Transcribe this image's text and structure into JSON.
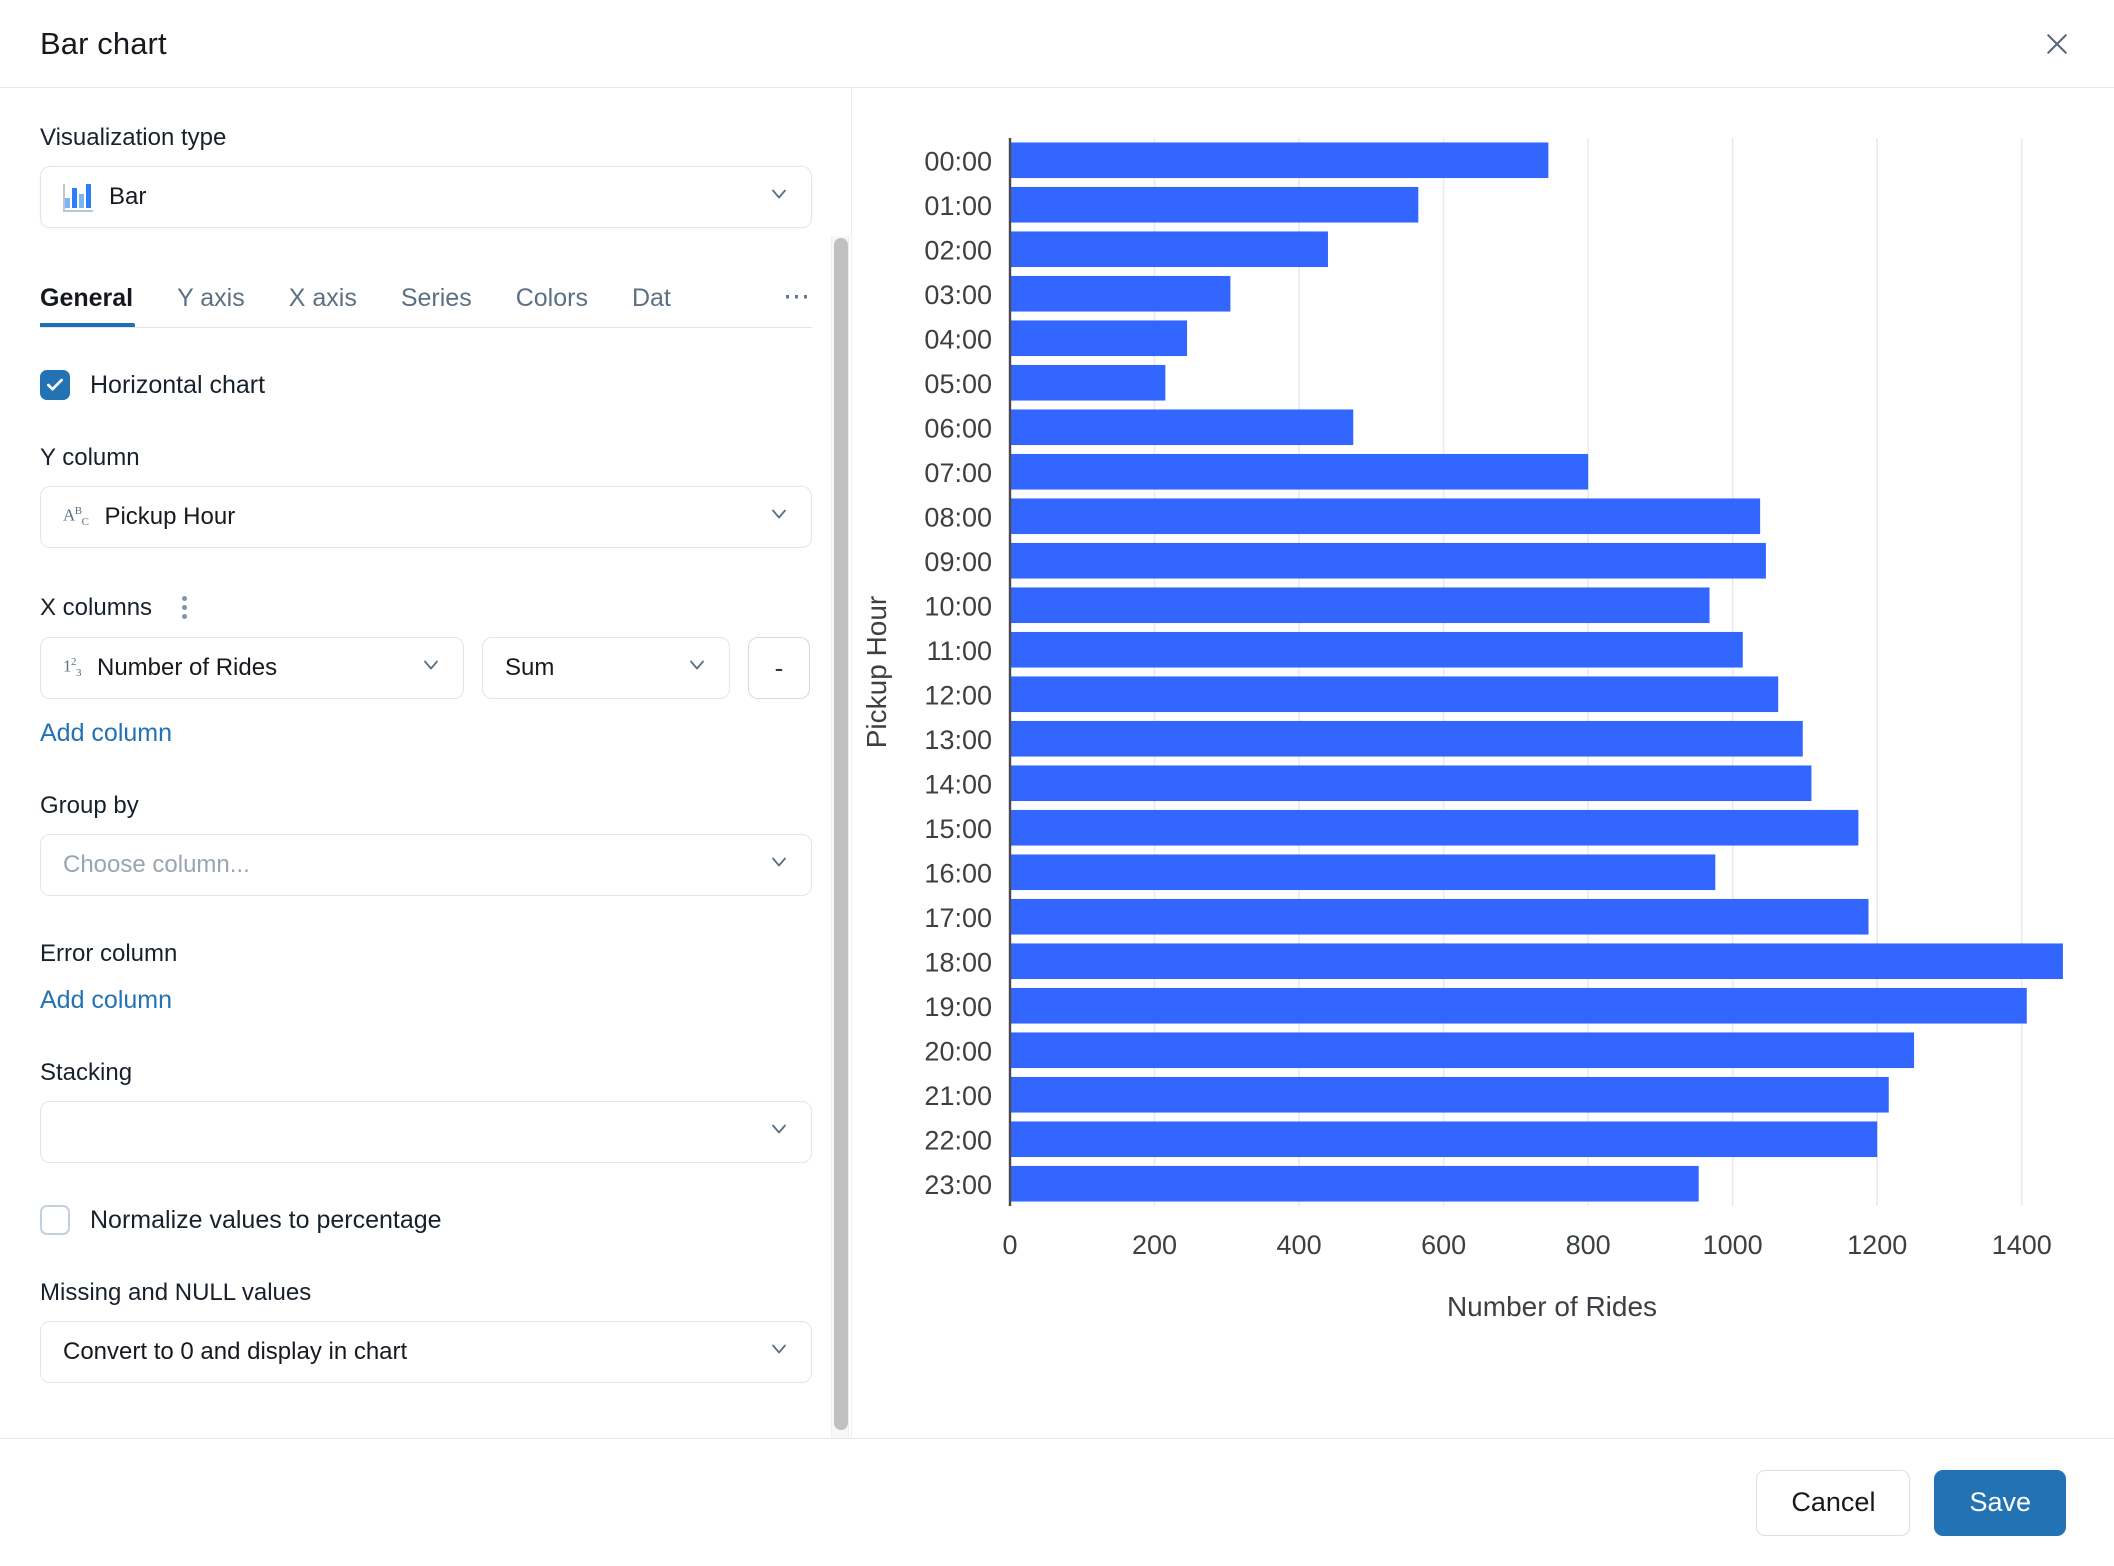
{
  "header": {
    "title": "Bar chart",
    "close_icon": "close-icon"
  },
  "settings": {
    "visualization_type_label": "Visualization type",
    "visualization_type_value": "Bar",
    "visualization_type_icon": "bar-chart-icon",
    "tabs": [
      {
        "label": "General",
        "active": true
      },
      {
        "label": "Y axis",
        "active": false
      },
      {
        "label": "X axis",
        "active": false
      },
      {
        "label": "Series",
        "active": false
      },
      {
        "label": "Colors",
        "active": false
      },
      {
        "label": "Dat",
        "active": false
      }
    ],
    "tabs_overflow": "⋯",
    "horizontal_chart_label": "Horizontal chart",
    "horizontal_chart_checked": true,
    "y_column_label": "Y column",
    "y_column_value": "Pickup Hour",
    "y_column_type_icon": "abc-text-type-icon",
    "x_columns_label": "X columns",
    "x_column_value": "Number of Rides",
    "x_column_type_icon": "123-number-type-icon",
    "x_aggregation_value": "Sum",
    "x_remove_label": "-",
    "x_add_column_label": "Add column",
    "group_by_label": "Group by",
    "group_by_placeholder": "Choose column...",
    "group_by_value": "",
    "error_column_label": "Error column",
    "error_add_column_label": "Add column",
    "stacking_label": "Stacking",
    "stacking_value": "",
    "normalize_label": "Normalize values to percentage",
    "normalize_checked": false,
    "missing_null_label": "Missing and NULL values",
    "missing_null_value": "Convert to 0 and display in chart"
  },
  "footer": {
    "cancel_label": "Cancel",
    "save_label": "Save"
  },
  "colors": {
    "bar": "#3366ff",
    "primary": "#2272b4",
    "link": "#2272b4",
    "grid": "#e8eaed",
    "axis": "#3c4043"
  },
  "chart_data": {
    "type": "bar",
    "orientation": "horizontal",
    "title": "",
    "xlabel": "Number of Rides",
    "ylabel": "Pickup Hour",
    "categories": [
      "00:00",
      "01:00",
      "02:00",
      "03:00",
      "04:00",
      "05:00",
      "06:00",
      "07:00",
      "08:00",
      "09:00",
      "10:00",
      "11:00",
      "12:00",
      "13:00",
      "14:00",
      "15:00",
      "16:00",
      "17:00",
      "18:00",
      "19:00",
      "20:00",
      "21:00",
      "22:00",
      "23:00"
    ],
    "values": [
      745,
      565,
      440,
      305,
      245,
      215,
      475,
      800,
      1038,
      1046,
      968,
      1014,
      1063,
      1097,
      1109,
      1174,
      976,
      1188,
      1457,
      1407,
      1251,
      1216,
      1200,
      953
    ],
    "xlim": [
      0,
      1500
    ],
    "xticks": [
      0,
      200,
      400,
      600,
      800,
      1000,
      1200,
      1400
    ],
    "xtick_labels": [
      "0",
      "200",
      "400",
      "600",
      "800",
      "1000",
      "1200",
      "1400"
    ],
    "grid": true,
    "grid_axis": "x",
    "legend": false,
    "bar_color": "#3366ff"
  }
}
